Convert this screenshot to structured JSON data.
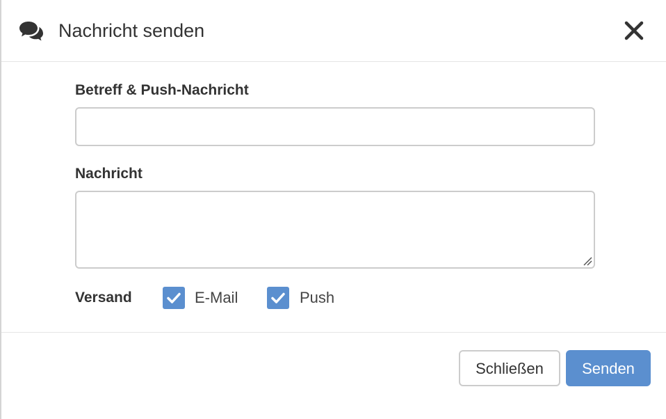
{
  "header": {
    "icon": "comments-icon",
    "title": "Nachricht senden",
    "close_icon": "close-icon"
  },
  "form": {
    "subject_label": "Betreff & Push-Nachricht",
    "subject_value": "",
    "message_label": "Nachricht",
    "message_value": "",
    "delivery_label": "Versand",
    "delivery_options": [
      {
        "label": "E-Mail",
        "checked": true
      },
      {
        "label": "Push",
        "checked": true
      }
    ]
  },
  "footer": {
    "close_label": "Schließen",
    "send_label": "Senden"
  },
  "colors": {
    "primary": "#5b8fcf",
    "border": "#cccccc",
    "text": "#333333"
  }
}
